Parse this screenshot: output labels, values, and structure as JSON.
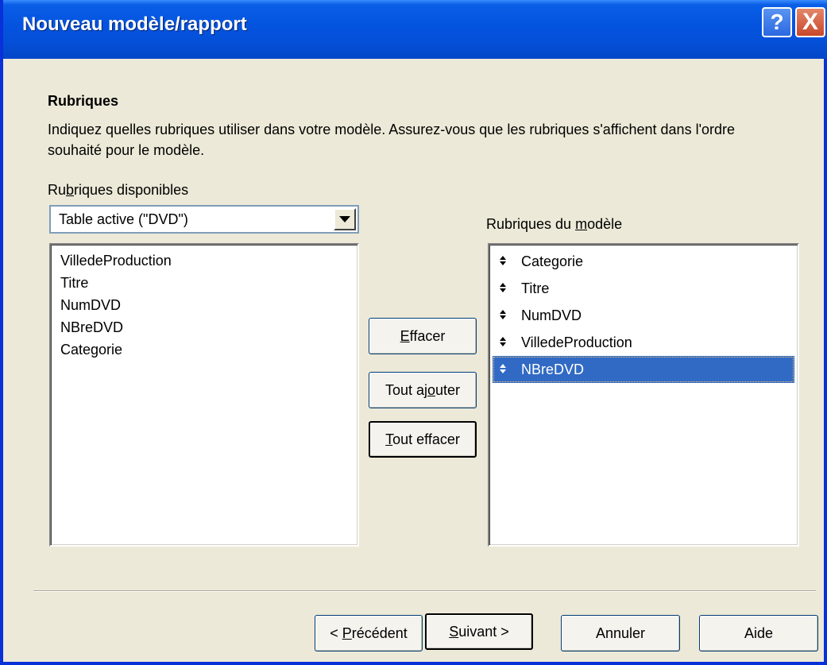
{
  "window": {
    "title": "Nouveau modèle/rapport",
    "help_label": "?",
    "close_label": "X"
  },
  "section": {
    "heading": "Rubriques",
    "description": "Indiquez quelles rubriques utiliser dans votre modèle. Assurez-vous que les rubriques s'affichent dans l'ordre souhaité pour le modèle."
  },
  "available": {
    "label": "Rubriques disponibles",
    "table_select": "Table active (\"DVD\")",
    "items": [
      "VilledeProduction",
      "Titre",
      "NumDVD",
      "NBreDVD",
      "Categorie"
    ]
  },
  "model": {
    "label": "Rubriques du modèle",
    "items": [
      "Categorie",
      "Titre",
      "NumDVD",
      "VilledeProduction",
      "NBreDVD"
    ],
    "selected": "NBreDVD"
  },
  "actions": {
    "remove": "Effacer",
    "add_all": "Tout ajouter",
    "remove_all": "Tout effacer"
  },
  "footer": {
    "previous": "< Précédent",
    "next": "Suivant >",
    "cancel": "Annuler",
    "help": "Aide"
  },
  "colors": {
    "titlebar": "#0454E0",
    "selection": "#316AC5",
    "dialog_bg": "#ECE9D8"
  }
}
